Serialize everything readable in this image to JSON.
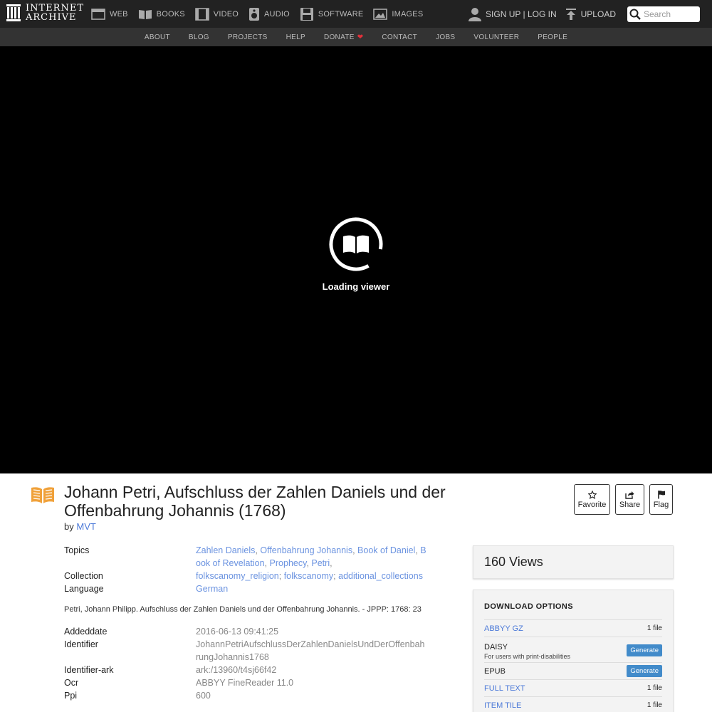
{
  "header": {
    "logo_line1": "INTERNET",
    "logo_line2": "ARCHIVE",
    "media": [
      {
        "label": "WEB",
        "icon": "web-icon"
      },
      {
        "label": "BOOKS",
        "icon": "books-icon"
      },
      {
        "label": "VIDEO",
        "icon": "video-icon"
      },
      {
        "label": "AUDIO",
        "icon": "audio-icon"
      },
      {
        "label": "SOFTWARE",
        "icon": "software-icon"
      },
      {
        "label": "IMAGES",
        "icon": "images-icon"
      }
    ],
    "signup_login": "SIGN UP | LOG IN",
    "upload": "UPLOAD",
    "search_placeholder": "Search"
  },
  "subnav": {
    "items": [
      "ABOUT",
      "BLOG",
      "PROJECTS",
      "HELP",
      "DONATE",
      "CONTACT",
      "JOBS",
      "VOLUNTEER",
      "PEOPLE"
    ]
  },
  "viewer": {
    "loading_text": "Loading viewer"
  },
  "item": {
    "title": "Johann Petri, Aufschluss der Zahlen Daniels und der Offenbahrung Johannis (1768)",
    "by_label": "by",
    "creator": "MVT",
    "actions": {
      "favorite": "Favorite",
      "share": "Share",
      "flag": "Flag"
    }
  },
  "metadata": {
    "topics_label": "Topics",
    "topics": [
      "Zahlen Daniels",
      "Offenbahrung Johannis",
      "Book of Daniel",
      "Book of Revelation",
      "Prophecy",
      "Petri"
    ],
    "collection_label": "Collection",
    "collections": [
      "folkscanomy_religion",
      "folkscanomy",
      "additional_collections"
    ],
    "language_label": "Language",
    "language": "German",
    "description": "Petri, Johann Philipp. Aufschluss der Zahlen Daniels und der Offenbahrung Johannis. - JPPP: 1768: 23",
    "fields": [
      {
        "key": "Addeddate",
        "value": "2016-06-13 09:41:25"
      },
      {
        "key": "Identifier",
        "value": "JohannPetriAufschlussDerZahlenDanielsUndDerOffenbahrungJohannis1768"
      },
      {
        "key": "Identifier-ark",
        "value": "ark:/13960/t4sj66f42"
      },
      {
        "key": "Ocr",
        "value": "ABBYY FineReader 11.0"
      },
      {
        "key": "Ppi",
        "value": "600"
      }
    ]
  },
  "sidebar": {
    "views": "160 Views",
    "download_heading": "DOWNLOAD OPTIONS",
    "downloads": {
      "abbyy": {
        "name": "ABBYY GZ",
        "count": "1 file"
      },
      "daisy": {
        "name": "DAISY",
        "sub": "For users with print-disabilities",
        "button": "Generate"
      },
      "epub": {
        "name": "EPUB",
        "button": "Generate"
      },
      "fulltext": {
        "name": "FULL TEXT",
        "count": "1 file"
      },
      "itemtile": {
        "name": "ITEM TILE",
        "count": "1 file"
      }
    }
  },
  "colors": {
    "link": "#4b79d8",
    "accent_book": "#f0a13a",
    "heart": "#e0303a",
    "generate_button": "#428bca"
  }
}
